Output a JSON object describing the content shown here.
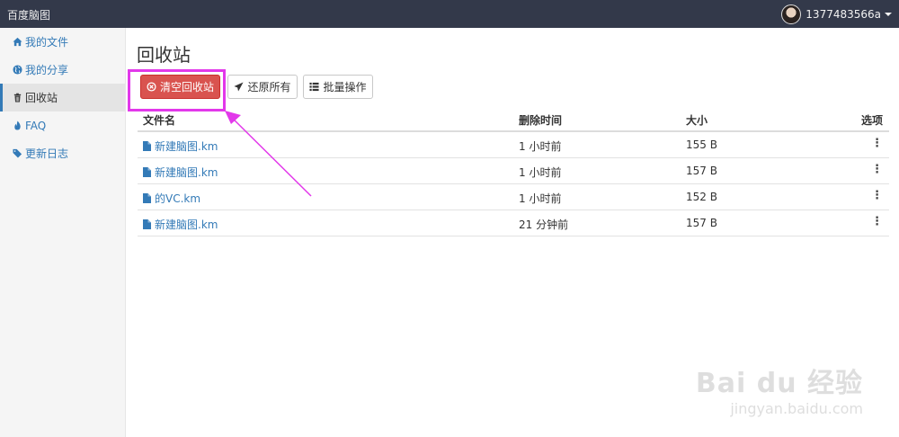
{
  "topbar": {
    "brand": "百度脑图",
    "username": "1377483566a"
  },
  "sidebar": {
    "items": [
      {
        "label": "我的文件",
        "icon": "home-icon"
      },
      {
        "label": "我的分享",
        "icon": "globe-icon"
      },
      {
        "label": "回收站",
        "icon": "trash-icon",
        "active": true
      },
      {
        "label": "FAQ",
        "icon": "fire-icon"
      },
      {
        "label": "更新日志",
        "icon": "tags-icon"
      }
    ]
  },
  "main": {
    "title": "回收站",
    "buttons": {
      "empty": "清空回收站",
      "restore": "还原所有",
      "batch": "批量操作"
    },
    "table": {
      "headers": [
        "文件名",
        "删除时间",
        "大小",
        "选项"
      ],
      "rows": [
        {
          "name": "新建脑图.km",
          "deleted": "1 小时前",
          "size": "155 B"
        },
        {
          "name": "新建脑图.km",
          "deleted": "1 小时前",
          "size": "157 B"
        },
        {
          "name": "的VC.km",
          "deleted": "1 小时前",
          "size": "152 B"
        },
        {
          "name": "新建脑图.km",
          "deleted": "21 分钟前",
          "size": "157 B"
        }
      ]
    }
  },
  "watermark": {
    "brand": "Bai du 经验",
    "url": "jingyan.baidu.com"
  },
  "colors": {
    "navbar": "#33394a",
    "link": "#337ab7",
    "danger": "#d9534f",
    "annotation": "#e238ea"
  }
}
